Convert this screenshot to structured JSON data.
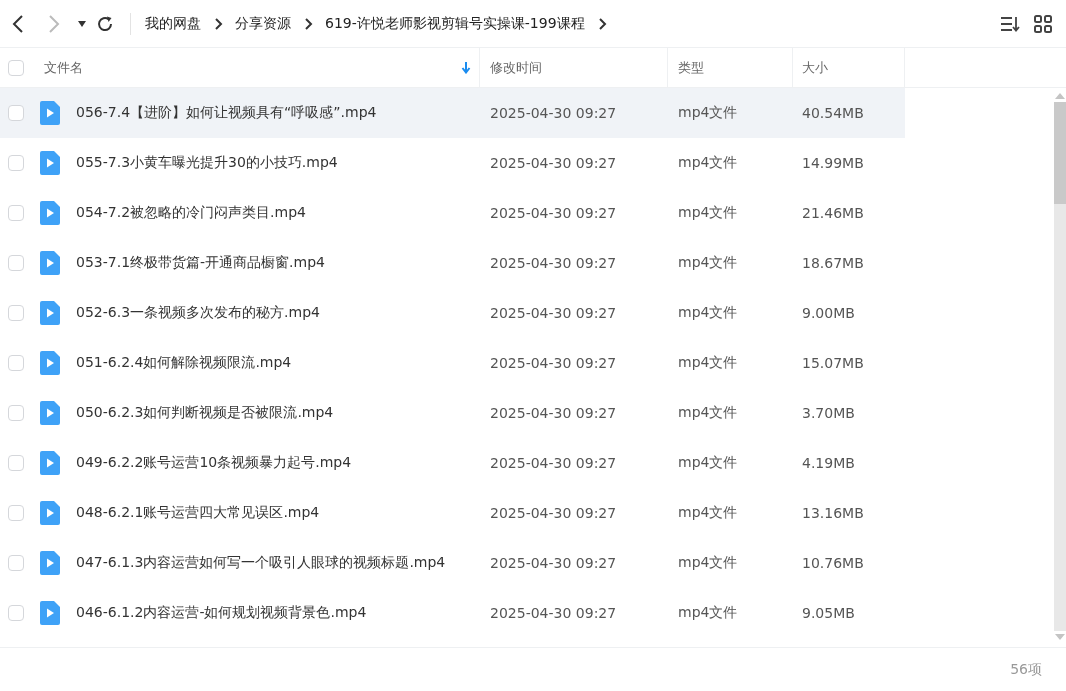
{
  "breadcrumbs": [
    "我的网盘",
    "分享资源",
    "619-许悦老师影视剪辑号实操课-199课程"
  ],
  "nav": {
    "back_disabled": false,
    "forward_disabled": true
  },
  "table": {
    "all_checked": false,
    "columns": [
      "文件名",
      "修改时间",
      "类型",
      "大小"
    ],
    "rows": [
      {
        "name": "056-7.4【进阶】如何让视频具有“呼吸感”.mp4",
        "modified": "2025-04-30 09:27",
        "type": "mp4文件",
        "size": "40.54MB",
        "checked": false,
        "hovered": true
      },
      {
        "name": "055-7.3小黄车曝光提升30的小技巧.mp4",
        "modified": "2025-04-30 09:27",
        "type": "mp4文件",
        "size": "14.99MB",
        "checked": false,
        "hovered": false
      },
      {
        "name": "054-7.2被忽略的冷门闷声类目.mp4",
        "modified": "2025-04-30 09:27",
        "type": "mp4文件",
        "size": "21.46MB",
        "checked": false,
        "hovered": false
      },
      {
        "name": "053-7.1终极带货篇-开通商品橱窗.mp4",
        "modified": "2025-04-30 09:27",
        "type": "mp4文件",
        "size": "18.67MB",
        "checked": false,
        "hovered": false
      },
      {
        "name": "052-6.3一条视频多次发布的秘方.mp4",
        "modified": "2025-04-30 09:27",
        "type": "mp4文件",
        "size": "9.00MB",
        "checked": false,
        "hovered": false
      },
      {
        "name": "051-6.2.4如何解除视频限流.mp4",
        "modified": "2025-04-30 09:27",
        "type": "mp4文件",
        "size": "15.07MB",
        "checked": false,
        "hovered": false
      },
      {
        "name": "050-6.2.3如何判断视频是否被限流.mp4",
        "modified": "2025-04-30 09:27",
        "type": "mp4文件",
        "size": "3.70MB",
        "checked": false,
        "hovered": false
      },
      {
        "name": "049-6.2.2账号运营10条视频暴力起号.mp4",
        "modified": "2025-04-30 09:27",
        "type": "mp4文件",
        "size": "4.19MB",
        "checked": false,
        "hovered": false
      },
      {
        "name": "048-6.2.1账号运营四大常见误区.mp4",
        "modified": "2025-04-30 09:27",
        "type": "mp4文件",
        "size": "13.16MB",
        "checked": false,
        "hovered": false
      },
      {
        "name": "047-6.1.3内容运营如何写一个吸引人眼球的视频标题.mp4",
        "modified": "2025-04-30 09:27",
        "type": "mp4文件",
        "size": "10.76MB",
        "checked": false,
        "hovered": false
      },
      {
        "name": "046-6.1.2内容运营-如何规划视频背景色.mp4",
        "modified": "2025-04-30 09:27",
        "type": "mp4文件",
        "size": "9.05MB",
        "checked": false,
        "hovered": false
      }
    ]
  },
  "status_bar": {
    "count": "56项"
  }
}
